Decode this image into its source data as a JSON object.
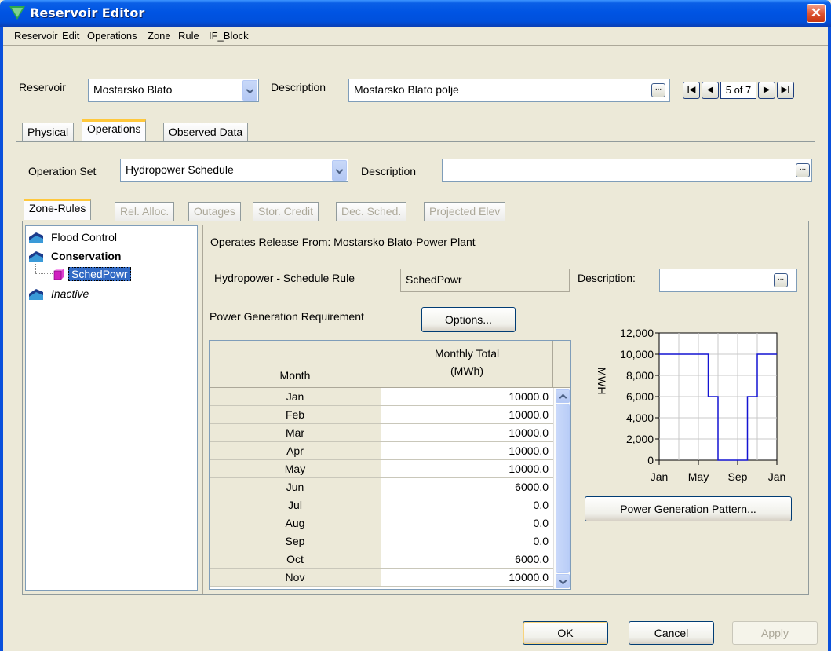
{
  "window": {
    "title": "Reservoir Editor",
    "close_glyph": "✕"
  },
  "menu": [
    "Reservoir",
    "Edit",
    "Operations",
    "Zone",
    "Rule",
    "IF_Block"
  ],
  "header": {
    "reservoir_label": "Reservoir",
    "reservoir_value": "Mostarsko Blato",
    "description_label": "Description",
    "description_value": "Mostarsko Blato polje",
    "record_position": "5 of 7"
  },
  "tabs": [
    "Physical",
    "Operations",
    "Observed Data"
  ],
  "active_tab": "Operations",
  "operations": {
    "operation_set_label": "Operation Set",
    "operation_set_value": "Hydropower Schedule",
    "description_label": "Description",
    "description_value": ""
  },
  "subtabs": [
    {
      "label": "Zone-Rules",
      "enabled": true
    },
    {
      "label": "Rel. Alloc.",
      "enabled": false
    },
    {
      "label": "Outages",
      "enabled": false
    },
    {
      "label": "Stor. Credit",
      "enabled": false
    },
    {
      "label": "Dec. Sched.",
      "enabled": false
    },
    {
      "label": "Projected Elev",
      "enabled": false
    }
  ],
  "tree": {
    "items": [
      {
        "label": "Flood Control",
        "icon": "zone-icon"
      },
      {
        "label": "Conservation",
        "icon": "zone-icon"
      },
      {
        "label": "SchedPowr",
        "icon": "rule-icon",
        "selected": true
      },
      {
        "label": "Inactive",
        "icon": "zone-icon"
      }
    ]
  },
  "rule": {
    "operates_release": "Operates Release From: Mostarsko Blato-Power Plant",
    "rule_type_label": "Hydropower - Schedule Rule",
    "rule_name": "SchedPowr",
    "description_label": "Description:",
    "description_value": "",
    "requirement_label": "Power Generation Requirement",
    "options_button": "Options...",
    "pattern_button": "Power Generation Pattern..."
  },
  "table": {
    "col_month": "Month",
    "col_total_line1": "Monthly Total",
    "col_total_line2": "(MWh)",
    "rows": [
      {
        "month": "Jan",
        "value": "10000.0"
      },
      {
        "month": "Feb",
        "value": "10000.0"
      },
      {
        "month": "Mar",
        "value": "10000.0"
      },
      {
        "month": "Apr",
        "value": "10000.0"
      },
      {
        "month": "May",
        "value": "10000.0"
      },
      {
        "month": "Jun",
        "value": "6000.0"
      },
      {
        "month": "Jul",
        "value": "0.0"
      },
      {
        "month": "Aug",
        "value": "0.0"
      },
      {
        "month": "Sep",
        "value": "0.0"
      },
      {
        "month": "Oct",
        "value": "6000.0"
      },
      {
        "month": "Nov",
        "value": "10000.0"
      }
    ]
  },
  "chart_data": {
    "type": "line",
    "step": true,
    "ylabel": "MWH",
    "ylim": [
      0,
      12000
    ],
    "yticks": [
      "0",
      "2,000",
      "4,000",
      "6,000",
      "8,000",
      "10,000",
      "12,000"
    ],
    "xticks": [
      "Jan",
      "May",
      "Sep",
      "Jan"
    ],
    "grid": true,
    "series": [
      {
        "color": "#1414d2",
        "x": [
          "Jan",
          "Feb",
          "Mar",
          "Apr",
          "May",
          "Jun",
          "Jul",
          "Aug",
          "Sep",
          "Oct",
          "Nov",
          "Dec"
        ],
        "values": [
          10000,
          10000,
          10000,
          10000,
          10000,
          6000,
          0,
          0,
          0,
          6000,
          10000,
          10000
        ]
      }
    ]
  },
  "footer": {
    "ok": "OK",
    "cancel": "Cancel",
    "apply": "Apply"
  },
  "colors": {
    "titlebar": "#0054e3",
    "tab_highlight": "#ffc83c",
    "selection": "#316ac5",
    "series_line": "#1414d2"
  }
}
